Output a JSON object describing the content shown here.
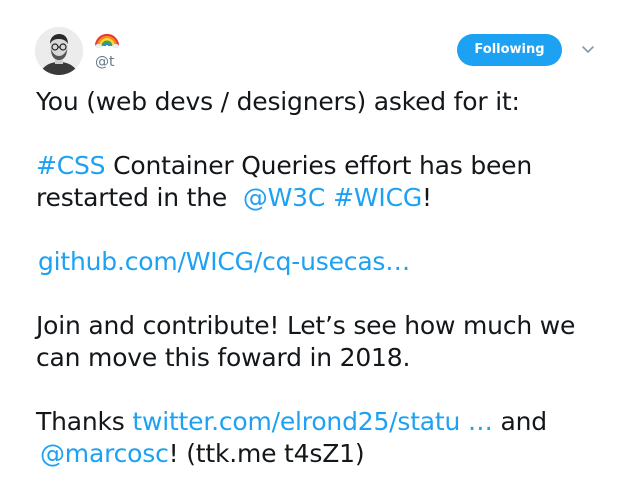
{
  "author": {
    "name_emoji": "rainbow-emoji",
    "handle": "@t",
    "avatar_icon": "avatar-photo"
  },
  "actions": {
    "follow_label": "Following",
    "menu_icon": "chevron-down-icon"
  },
  "colors": {
    "accent": "#1da1f2",
    "text": "#14171a",
    "muted": "#657786"
  },
  "tweet": {
    "line1": "You (web devs / designers) asked for it:",
    "p2_hashtag_css": "#CSS",
    "p2_text_a": " Container Queries effort has been",
    "p2_text_b": "restarted in the ",
    "p2_mention_w3c": "@W3C",
    "p2_hashtag_wicg": "#WICG",
    "p2_text_c": "!",
    "link1": "github.com/WICG/cq-usecas…",
    "p4_line1": "Join and contribute! Let’s see how much we",
    "p4_line2": "can move this foward in 2018.",
    "p5_text_a": "Thanks ",
    "p5_link": "twitter.com/elrond25/statu …",
    "p5_text_b": " and",
    "p5_mention": "@marcosc",
    "p5_text_c": "! (ttk.me t4sZ1)"
  }
}
